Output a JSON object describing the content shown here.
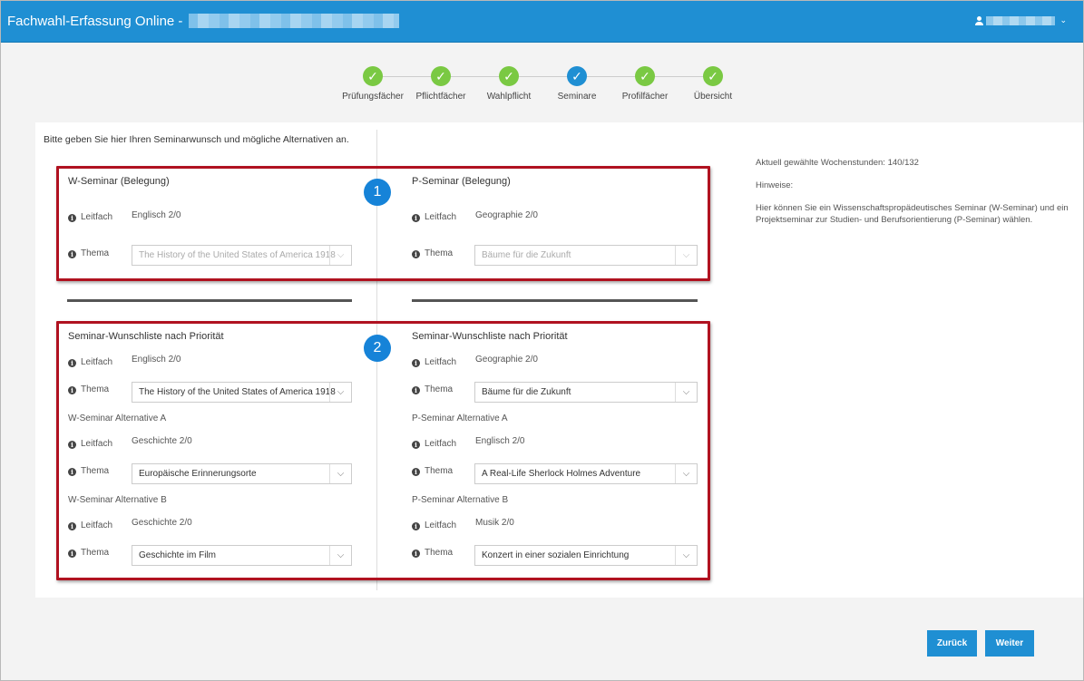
{
  "header": {
    "title": "Fachwahl-Erfassung Online -",
    "user_icon": "user-icon",
    "user_menu_icon": "chevron-down-icon"
  },
  "stepper": {
    "steps": [
      {
        "label": "Prüfungsfächer",
        "status": "done"
      },
      {
        "label": "Pflichtfächer",
        "status": "done"
      },
      {
        "label": "Wahlpflicht",
        "status": "done"
      },
      {
        "label": "Seminare",
        "status": "active"
      },
      {
        "label": "Profilfächer",
        "status": "done"
      },
      {
        "label": "Übersicht",
        "status": "done"
      }
    ],
    "check_glyph": "✓"
  },
  "main": {
    "intro": "Bitte geben Sie hier Ihren Seminarwunsch und mögliche Alternativen an.",
    "badges": [
      "1",
      "2"
    ],
    "labels": {
      "leitfach": "Leitfach",
      "thema": "Thema"
    },
    "belegung": {
      "w": {
        "title": "W-Seminar (Belegung)",
        "leitfach": "Englisch 2/0",
        "thema": "The History of the United States of America 1918"
      },
      "p": {
        "title": "P-Seminar (Belegung)",
        "leitfach": "Geographie 2/0",
        "thema": "Bäume für die Zukunft"
      }
    },
    "wunschliste": {
      "w": {
        "title": "Seminar-Wunschliste nach Priorität",
        "leitfach": "Englisch 2/0",
        "thema": "The History of the United States of America 1918",
        "alt_a": {
          "title": "W-Seminar Alternative A",
          "leitfach": "Geschichte 2/0",
          "thema": "Europäische Erinnerungsorte"
        },
        "alt_b": {
          "title": "W-Seminar Alternative B",
          "leitfach": "Geschichte 2/0",
          "thema": "Geschichte im Film"
        }
      },
      "p": {
        "title": "Seminar-Wunschliste nach Priorität",
        "leitfach": "Geographie 2/0",
        "thema": "Bäume für die Zukunft",
        "alt_a": {
          "title": "P-Seminar Alternative A",
          "leitfach": "Englisch 2/0",
          "thema": "A Real-Life Sherlock Holmes Adventure"
        },
        "alt_b": {
          "title": "P-Seminar Alternative B",
          "leitfach": "Musik 2/0",
          "thema": "Konzert in einer sozialen Einrichtung"
        }
      }
    }
  },
  "sidebar": {
    "hours": "Aktuell gewählte Wochenstunden: 140/132",
    "hints_title": "Hinweise:",
    "hints_text": "Hier können Sie ein Wissenschaftspropädeutisches Seminar (W-Seminar) und ein Projektseminar zur Studien- und Berufsorientierung (P-Seminar) wählen."
  },
  "footer": {
    "back": "Zurück",
    "next": "Weiter"
  },
  "colors": {
    "accent": "#1f8fd3",
    "done": "#7ac943",
    "highlight": "#b01220"
  }
}
